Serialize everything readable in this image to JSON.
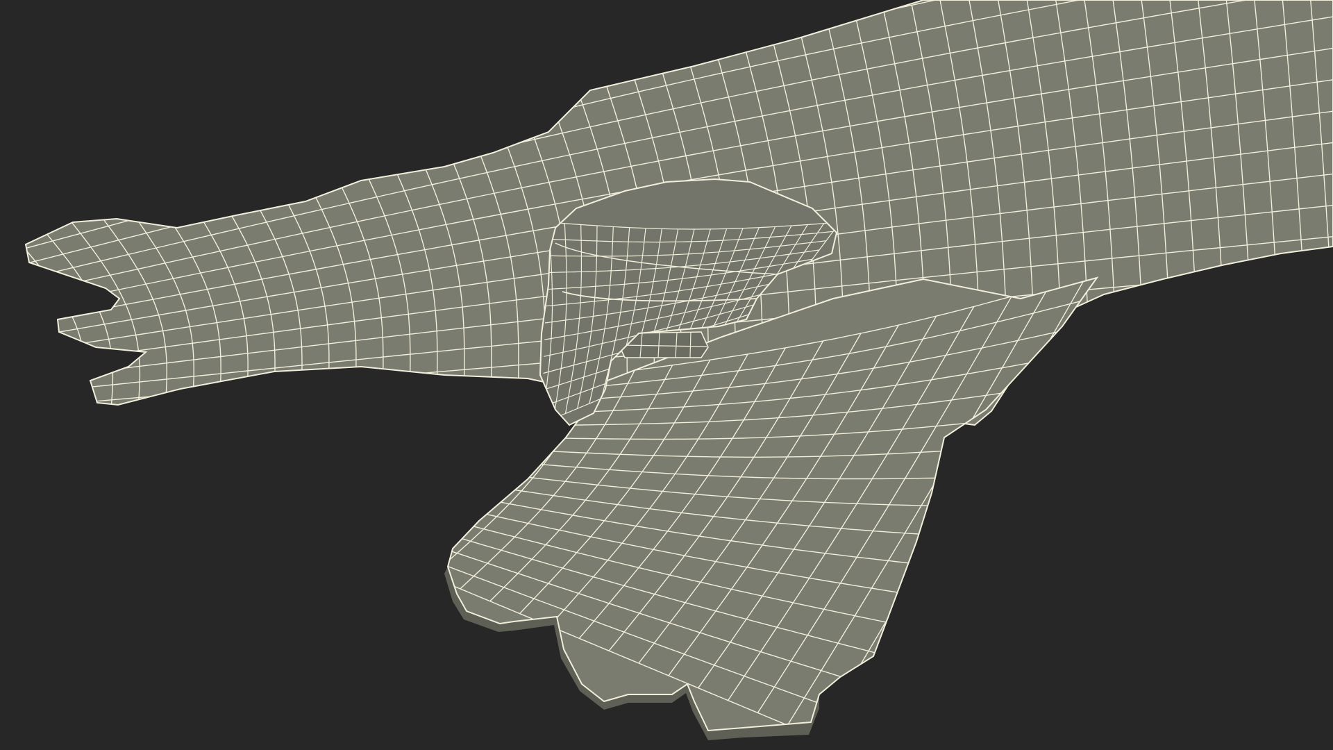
{
  "scene": {
    "background_color": "#272727",
    "surface_color": "#7b7c70",
    "surface_shadow_color": "#5f6055",
    "edge_color": "#6c6d62",
    "wire_color": "#f1efdc",
    "objects": [
      "upper-jaw-plate",
      "lower-jaw-plate",
      "hinge-clip",
      "hinge-tab"
    ]
  }
}
